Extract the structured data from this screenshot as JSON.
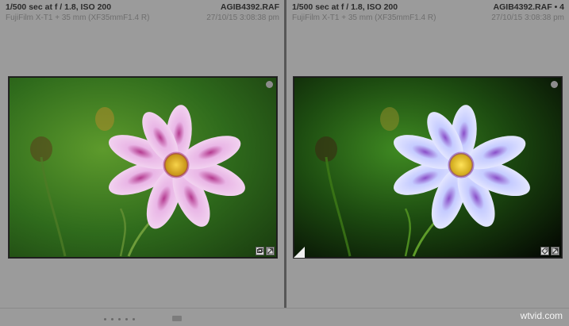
{
  "left_pane": {
    "exposure": "1/500 sec at f / 1.8, ISO 200",
    "filename": "AGIB4392.RAF",
    "camera": "FujiFilm X-T1 + 35 mm (XF35mmF1.4 R)",
    "datetime": "27/10/15 3:08:38 pm",
    "badge_icons": [
      "crop-badge-icon",
      "develop-badge-icon"
    ]
  },
  "right_pane": {
    "exposure": "1/500 sec at f / 1.8, ISO 200",
    "filename": "AGIB4392.RAF",
    "copy_indicator": "• 4",
    "camera": "FujiFilm X-T1 + 35 mm (XF35mmF1.4 R)",
    "datetime": "27/10/15 3:08:38 pm",
    "badge_icons": [
      "keyword-badge-icon",
      "develop-badge-icon"
    ]
  },
  "footer": {
    "watermark": "wtvid.com"
  },
  "colors": {
    "panel_bg": "#9b9b9b",
    "photo_bg_left": "#2f6b1c",
    "photo_bg_right": "#0f1f0a",
    "petal_left": "#e9b6e6",
    "petal_right": "#c5cbff",
    "center": "#f3c21a"
  }
}
